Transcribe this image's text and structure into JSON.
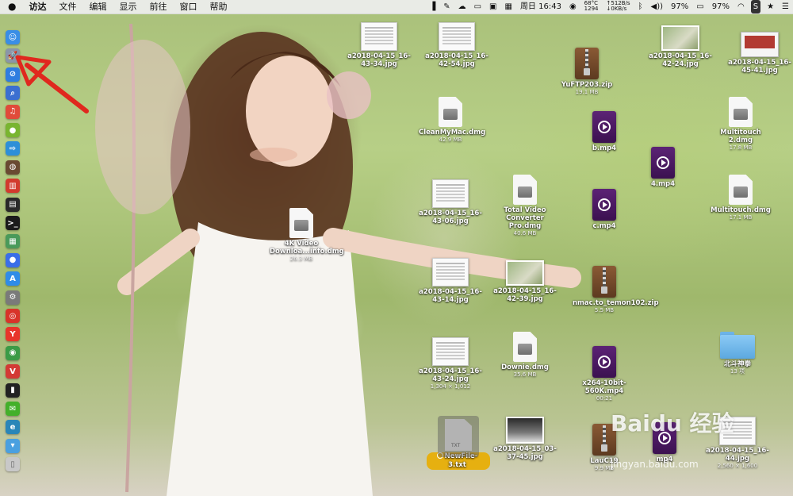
{
  "menubar": {
    "apple_icon": "apple-logo-icon",
    "app_name": "访达",
    "menus": [
      "文件",
      "编辑",
      "显示",
      "前往",
      "窗口",
      "帮助"
    ],
    "status": {
      "temperature": "68°C",
      "fan": "1294",
      "net_up": "↑512B/s",
      "net_down": "↓0KB/s",
      "clock": "周日 16:43",
      "battery_left": "97%",
      "battery_right": "97%"
    }
  },
  "dock": {
    "items": [
      {
        "name": "finder-icon",
        "color": "#3a8ee6"
      },
      {
        "name": "launchpad-icon",
        "color": "#8a96a8"
      },
      {
        "name": "safari-icon",
        "color": "#2f7de0"
      },
      {
        "name": "search-app-icon",
        "color": "#3b6fd1"
      },
      {
        "name": "music-app-icon",
        "color": "#e04b3a"
      },
      {
        "name": "android-icon",
        "color": "#79b530"
      },
      {
        "name": "migration-icon",
        "color": "#2d8fd8"
      },
      {
        "name": "planet-icon",
        "color": "#6a4a32"
      },
      {
        "name": "audio-app-icon",
        "color": "#d23b2e"
      },
      {
        "name": "activity-monitor-icon",
        "color": "#2a2a2a"
      },
      {
        "name": "terminal-icon",
        "color": "#1b1b1b"
      },
      {
        "name": "preview-icon",
        "color": "#4a9a5a"
      },
      {
        "name": "siri-icon",
        "color": "#3a6ee8"
      },
      {
        "name": "app-store-icon",
        "color": "#2f8ce8"
      },
      {
        "name": "system-preferences-icon",
        "color": "#7a7a7a"
      },
      {
        "name": "netease-music-icon",
        "color": "#d8342a"
      },
      {
        "name": "yandex-icon",
        "color": "#e8352a"
      },
      {
        "name": "chrome-icon",
        "color": "#3b9b46"
      },
      {
        "name": "vivaldi-icon",
        "color": "#d33a35"
      },
      {
        "name": "console-icon",
        "color": "#222222"
      },
      {
        "name": "wechat-icon",
        "color": "#43b02a"
      },
      {
        "name": "edge-icon",
        "color": "#2a86b8"
      },
      {
        "name": "downloads-folder-icon",
        "color": "#4aa0e0"
      },
      {
        "name": "trash-icon",
        "color": "#c8c8c8"
      }
    ]
  },
  "desktop": {
    "files": [
      {
        "label": "a2018-04-15_16-43-34.jpg",
        "kind": "thumb"
      },
      {
        "label": "a2018-04-15_16-42-54.jpg",
        "kind": "thumb"
      },
      {
        "label": "YuFTP203.zip",
        "sub": "19.1 MB",
        "kind": "zip"
      },
      {
        "label": "a2018-04-15_16-42-24.jpg",
        "kind": "photo"
      },
      {
        "label": "a2018-04-15_16-45-41.jpg",
        "kind": "red"
      },
      {
        "label": "CleanMyMac.dmg",
        "sub": "42.9 MB",
        "kind": "dmg"
      },
      {
        "label": "b.mp4",
        "kind": "mp4"
      },
      {
        "label": "Multitouch 2.dmg",
        "sub": "17.8 MB",
        "kind": "dmg"
      },
      {
        "label": "4.mp4",
        "kind": "mp4"
      },
      {
        "label": "a2018-04-15_16-43-06.jpg",
        "kind": "thumb"
      },
      {
        "label": "Total Video Converter Pro.dmg",
        "sub": "40.6 MB",
        "kind": "dmg"
      },
      {
        "label": "c.mp4",
        "kind": "mp4"
      },
      {
        "label": "Multitouch.dmg",
        "sub": "17.1 MB",
        "kind": "dmg"
      },
      {
        "label": "4K Video Downloa...info.dmg",
        "sub": "26.3 MB",
        "kind": "dmg"
      },
      {
        "label": "a2018-04-15_16-43-14.jpg",
        "kind": "thumb"
      },
      {
        "label": "a2018-04-15_16-42-39.jpg",
        "kind": "photo"
      },
      {
        "label": "nmac.to_temon102.zip",
        "sub": "5.5 MB",
        "kind": "zip"
      },
      {
        "label": "北斗神拳",
        "sub": "13 项",
        "kind": "folder"
      },
      {
        "label": "a2018-04-15_16-43-24.jpg",
        "sub": "1,304 × 1,012",
        "kind": "thumb"
      },
      {
        "label": "Downie.dmg",
        "sub": "35.6 MB",
        "kind": "dmg"
      },
      {
        "label": "x264-10bit-560K.mp4",
        "sub": "00:21",
        "kind": "mp4"
      },
      {
        "label": "NewFile-3.txt",
        "kind": "txt"
      },
      {
        "label": "a2018-04-15_03-37-45.jpg",
        "kind": "dark"
      },
      {
        "label": "LauC19",
        "sub": "9.9 MB",
        "kind": "zip"
      },
      {
        "label": "mp4",
        "kind": "mp4"
      },
      {
        "label": "a2018-04-15_16-44.jpg",
        "sub": "2,560 × 1,600",
        "kind": "thumb"
      }
    ],
    "txt_icon_text": "TXT"
  },
  "watermark": {
    "main": "Baidu 经验",
    "sub": "jingyan.baidu.com"
  },
  "annotation": {
    "arrow_color": "#e0281e"
  }
}
